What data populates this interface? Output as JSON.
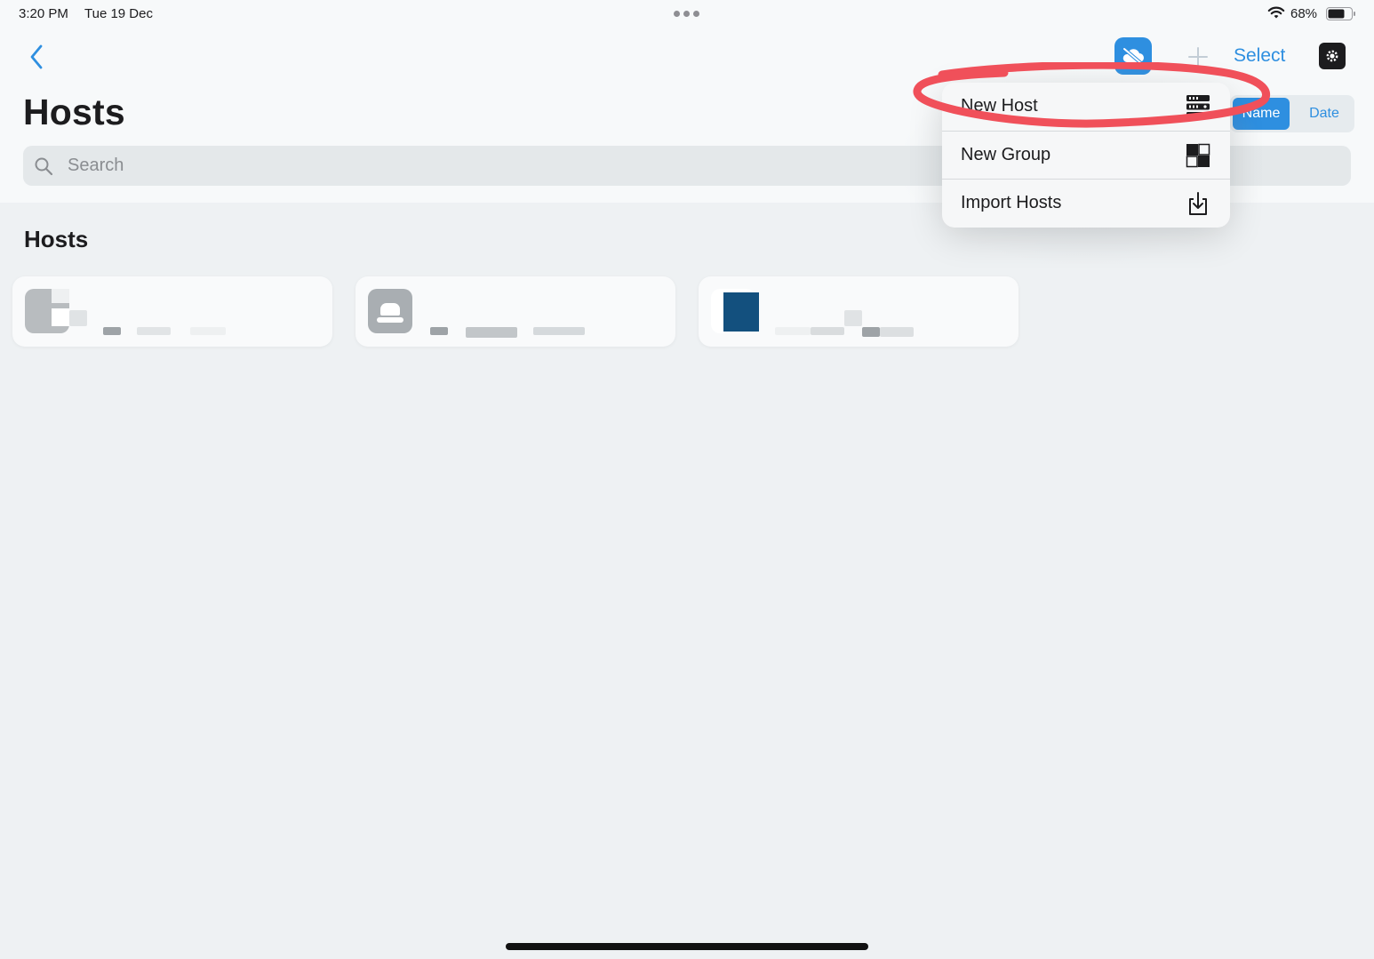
{
  "status_bar": {
    "time": "3:20 PM",
    "date": "Tue 19 Dec",
    "battery": "68%"
  },
  "nav": {
    "back_icon": "chevron-left-icon",
    "sync_icon": "cloud-off-icon",
    "add_icon": "plus-icon",
    "select_label": "Select",
    "settings_icon": "gear-icon"
  },
  "page": {
    "title": "Hosts"
  },
  "sort": {
    "options": [
      "Name",
      "Date"
    ],
    "selected": "Name"
  },
  "search": {
    "placeholder": "Search",
    "value": ""
  },
  "section": {
    "title": "Hosts"
  },
  "menu": {
    "items": [
      {
        "label": "New Host",
        "icon": "server-icon"
      },
      {
        "label": "New Group",
        "icon": "group-icon"
      },
      {
        "label": "Import Hosts",
        "icon": "import-icon"
      }
    ]
  },
  "annotation": {
    "color": "#f0505a",
    "target": "New Host"
  },
  "colors": {
    "accent": "#2e8fe0",
    "background": "#eef1f3",
    "header": "#f7f9fa"
  }
}
